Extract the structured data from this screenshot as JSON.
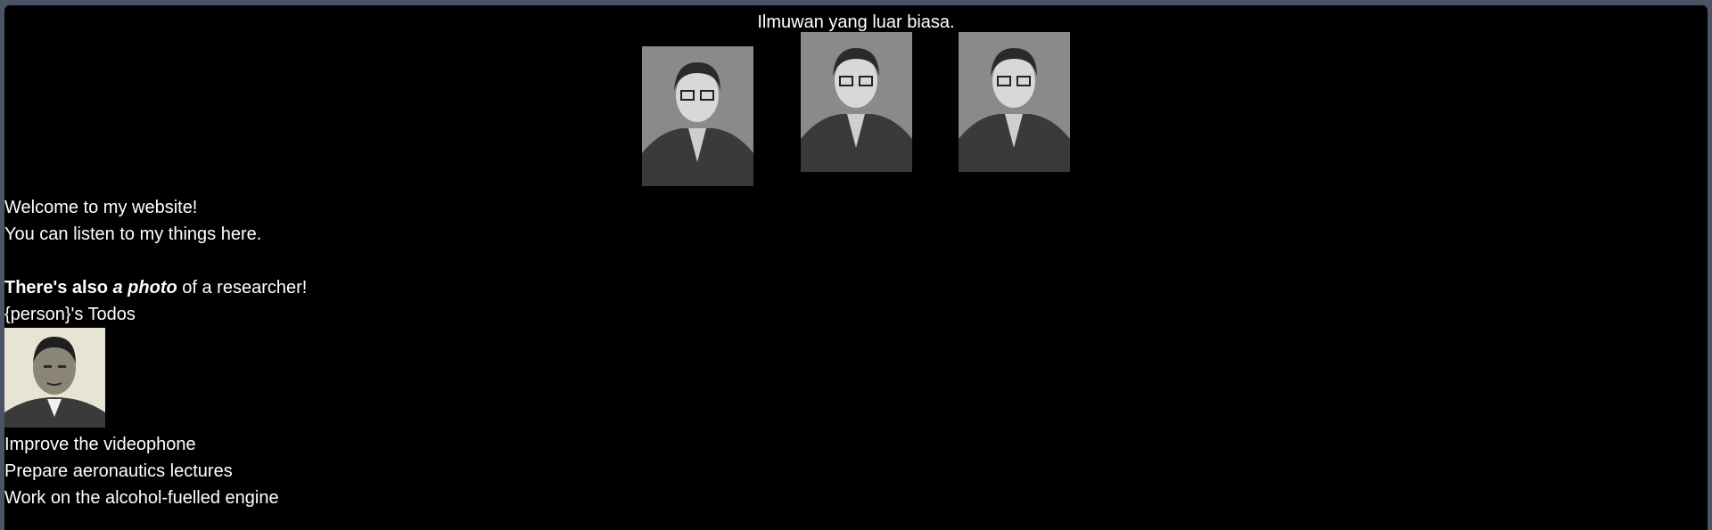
{
  "header": {
    "title": "Ilmuwan yang luar biasa."
  },
  "gallery": {
    "photos": [
      {
        "icon": "portrait-photo"
      },
      {
        "icon": "portrait-photo"
      },
      {
        "icon": "portrait-photo"
      }
    ]
  },
  "intro": {
    "welcome": "Welcome to my website!",
    "listen": "You can listen to my things here.",
    "photo_prefix": "There's also",
    "photo_emph": "a photo",
    "photo_suffix": " of a researcher!"
  },
  "todos": {
    "heading": "{person}'s Todos",
    "avatar_icon": "researcher-photo",
    "items": [
      "Improve the videophone",
      "Prepare aeronautics lectures",
      "Work on the alcohol-fuelled engine"
    ]
  },
  "colors": {
    "background": "#000000",
    "frame": "#4a5466",
    "text": "#ffffff"
  }
}
